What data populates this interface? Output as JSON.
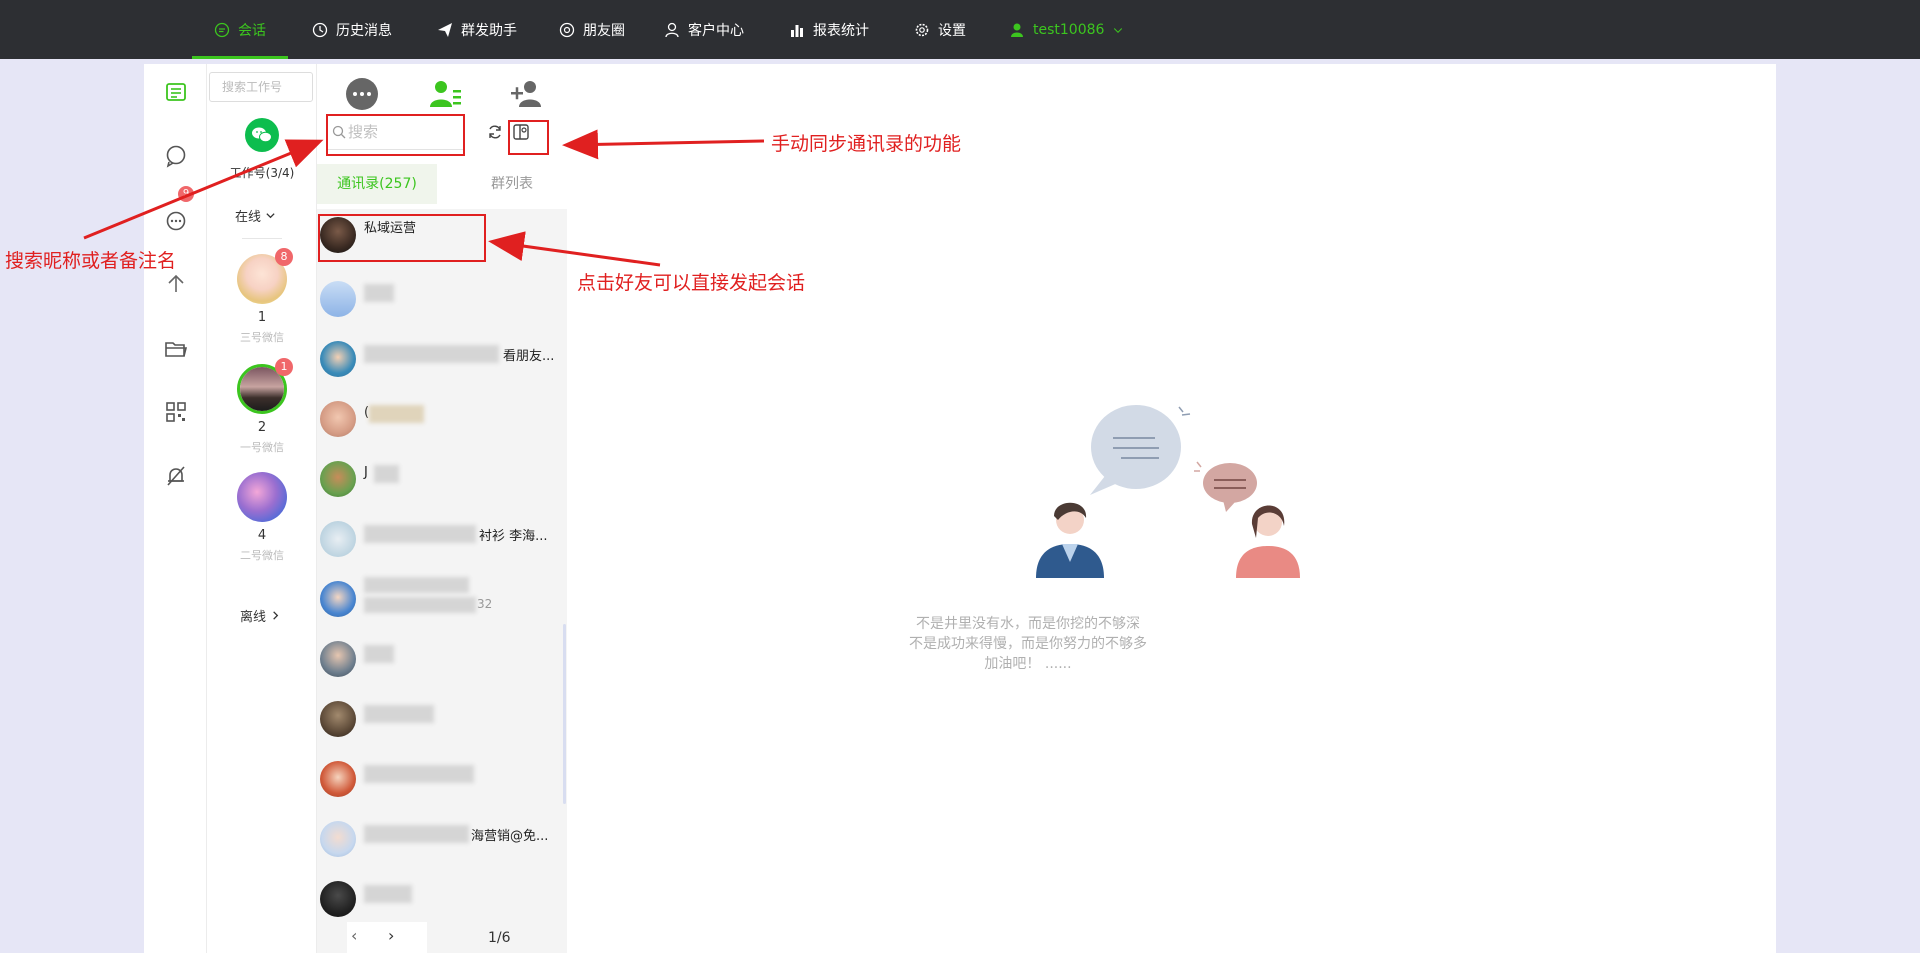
{
  "nav": {
    "items": [
      {
        "label": "会话",
        "icon": "chat-bubble-icon"
      },
      {
        "label": "历史消息",
        "icon": "clock-icon"
      },
      {
        "label": "群发助手",
        "icon": "send-icon"
      },
      {
        "label": "朋友圈",
        "icon": "aperture-icon"
      },
      {
        "label": "客户中心",
        "icon": "user-icon"
      },
      {
        "label": "报表统计",
        "icon": "bar-chart-icon"
      },
      {
        "label": "设置",
        "icon": "gear-icon"
      }
    ],
    "user": "test10086"
  },
  "rail": {
    "badge": "9"
  },
  "work": {
    "search_placeholder": "搜索工作号",
    "count": "工作号(3/4)",
    "online": "在线",
    "offline": "离线",
    "accounts": [
      {
        "num": "1",
        "name": "三号微信",
        "badge": "8"
      },
      {
        "num": "2",
        "name": "一号微信",
        "badge": "1"
      },
      {
        "num": "4",
        "name": "二号微信",
        "badge": ""
      }
    ]
  },
  "contacts": {
    "search_placeholder": "搜索",
    "tab_contacts": "通讯录(257)",
    "tab_groups": "群列表",
    "rows": [
      {
        "name": "私域运营"
      },
      {
        "name": ""
      },
      {
        "name": "看朋友..."
      },
      {
        "name": "("
      },
      {
        "name": "J"
      },
      {
        "name": "衬衫 李海..."
      },
      {
        "name": "32"
      },
      {
        "name": ""
      },
      {
        "name": ""
      },
      {
        "name": ""
      },
      {
        "name": "海营销@免..."
      },
      {
        "name": ""
      }
    ],
    "page": "1/6"
  },
  "empty": {
    "line1": "不是井里没有水，而是你挖的不够深",
    "line2": "不是成功来得慢，而是你努力的不够多",
    "line3": "加油吧！ ......"
  },
  "annotations": {
    "sync": "手动同步通讯录的功能",
    "search": "搜索昵称或者备注名",
    "click": "点击好友可以直接发起会话"
  },
  "colors": {
    "accent": "#3cc51f",
    "topbar": "#2d2f33",
    "annotation": "#e02020",
    "badge": "#f0676a"
  }
}
